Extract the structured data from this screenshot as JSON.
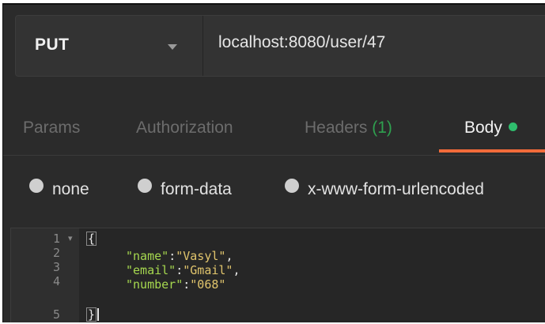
{
  "request": {
    "method": "PUT",
    "url": "localhost:8080/user/47"
  },
  "tabs": [
    {
      "label": "Params"
    },
    {
      "label": "Authorization"
    },
    {
      "label": "Headers",
      "count": "(1)"
    },
    {
      "label": "Body",
      "active": true
    }
  ],
  "body_modes": [
    {
      "label": "none"
    },
    {
      "label": "form-data"
    },
    {
      "label": "x-www-form-urlencoded"
    }
  ],
  "editor": {
    "line_numbers": [
      "1",
      "2",
      "3",
      "4",
      "5"
    ],
    "open_brace": "{",
    "close_brace": "}",
    "fields": [
      {
        "key": "\"name\"",
        "value": "\"Vasyl\"",
        "sep": ","
      },
      {
        "key": "\"email\"",
        "value": "\"Gmail\"",
        "sep": ","
      },
      {
        "key": "\"number\"",
        "value": "\"068\"",
        "sep": ""
      }
    ]
  },
  "colors": {
    "background": "#2b2b2b",
    "active_tab_underline": "#f26b3a",
    "body_dot": "#2fbd6d",
    "headers_count": "#2fa04f",
    "json_key": "#a6d84f",
    "json_string": "#e0c46c"
  }
}
